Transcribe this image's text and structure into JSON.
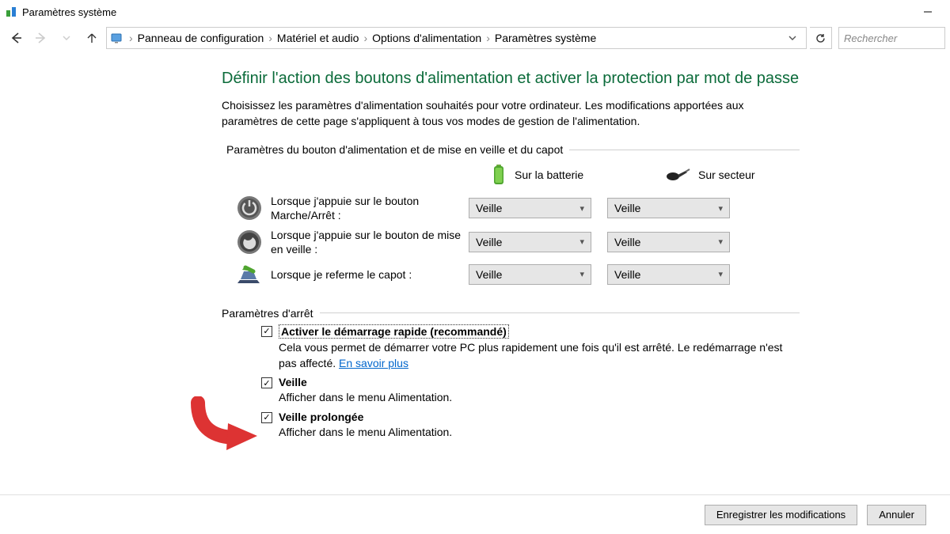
{
  "window": {
    "title": "Paramètres système"
  },
  "breadcrumb": {
    "items": [
      "Panneau de configuration",
      "Matériel et audio",
      "Options d'alimentation",
      "Paramètres système"
    ]
  },
  "search": {
    "placeholder": "Rechercher"
  },
  "page": {
    "heading": "Définir l'action des boutons d'alimentation et activer la protection par mot de passe",
    "description": "Choisissez les paramètres d'alimentation souhaités pour votre ordinateur. Les modifications apportées aux paramètres de cette page s'appliquent à tous vos modes de gestion de l'alimentation."
  },
  "group1": {
    "label": "Paramètres du bouton d'alimentation et de mise en veille et du capot"
  },
  "legend": {
    "battery": "Sur la batterie",
    "plugged": "Sur secteur"
  },
  "rows": [
    {
      "label": "Lorsque j'appuie sur le bouton Marche/Arrêt :",
      "battery": "Veille",
      "plugged": "Veille"
    },
    {
      "label": "Lorsque j'appuie sur le bouton de mise en veille :",
      "battery": "Veille",
      "plugged": "Veille"
    },
    {
      "label": "Lorsque je referme le capot :",
      "battery": "Veille",
      "plugged": "Veille"
    }
  ],
  "group2": {
    "label": "Paramètres d'arrêt"
  },
  "checkboxes": [
    {
      "label": "Activer le démarrage rapide (recommandé)",
      "checked": true,
      "highlighted": true,
      "desc_prefix": "Cela vous permet de démarrer votre PC plus rapidement une fois qu'il est arrêté. Le redémarrage n'est pas affecté. ",
      "link": "En savoir plus"
    },
    {
      "label": "Veille",
      "checked": true,
      "desc": "Afficher dans le menu Alimentation."
    },
    {
      "label": "Veille prolongée",
      "checked": true,
      "desc": "Afficher dans le menu Alimentation."
    }
  ],
  "footer": {
    "save": "Enregistrer les modifications",
    "cancel": "Annuler"
  }
}
